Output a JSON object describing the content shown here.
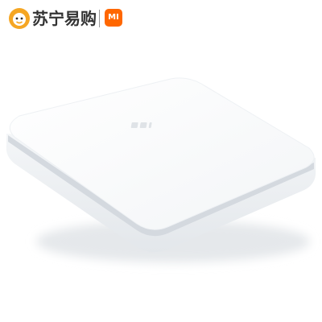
{
  "header": {
    "brand_text": "苏宁易购",
    "partner_logo_text": "MI",
    "suning_color": "#f5a623",
    "mi_color": "#ff6700"
  },
  "product": {
    "logo_text": "mi",
    "body_color": "#ffffff",
    "edge_color": "#e8ebef",
    "stripe_color": "#d4d9df"
  }
}
